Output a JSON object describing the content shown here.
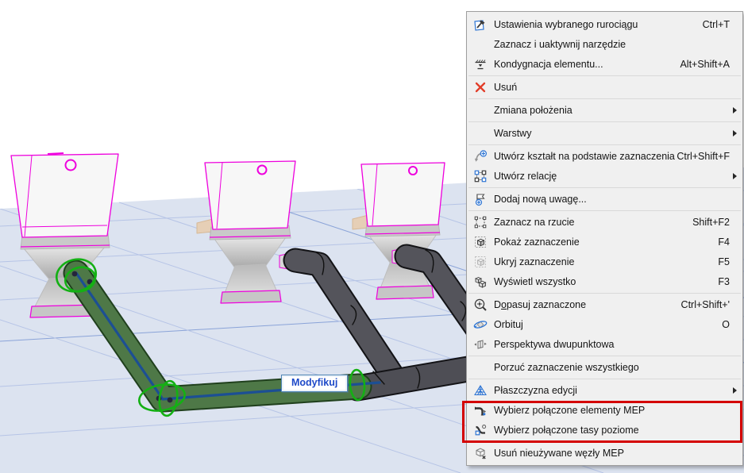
{
  "scene": {
    "tooltip": "Modyfikuj",
    "colors": {
      "floor": "#dce3f0",
      "grid_minor": "#b6c4e6",
      "grid_major": "#8aa3d8",
      "selection_green": "#14b014",
      "pipe_green": "#4e7847",
      "pipe_dark": "#54545b",
      "toilet_outline": "#ee00dd",
      "centerline_blue": "#1c4f94",
      "highlight_red": "#d40000",
      "tooltip_text": "#1d49c8"
    }
  },
  "menu": {
    "items": [
      {
        "label": "Ustawienia wybranego rurociągu",
        "shortcut": "Ctrl+T",
        "icon": "pipe-settings"
      },
      {
        "label": "Zaznacz i uaktywnij narzędzie",
        "shortcut": ""
      },
      {
        "label": "Kondygnacja elementu...",
        "shortcut": "Alt+Shift+A",
        "icon": "story-level"
      },
      {
        "label": "Usuń",
        "shortcut": "",
        "icon": "delete"
      },
      {
        "label": "Zmiana położenia",
        "shortcut": "",
        "submenu": true
      },
      {
        "label": "Warstwy",
        "shortcut": "",
        "submenu": true
      },
      {
        "label": "Utwórz kształt na podstawie zaznaczenia",
        "shortcut": "Ctrl+Shift+F",
        "icon": "morph-from-selection"
      },
      {
        "label": "Utwórz relację",
        "shortcut": "",
        "submenu": true,
        "icon": "create-relation"
      },
      {
        "label": "Dodaj nową uwagę...",
        "shortcut": "",
        "icon": "add-note"
      },
      {
        "label": "Zaznacz na rzucie",
        "shortcut": "Shift+F2",
        "icon": "select-on-plan"
      },
      {
        "label": "Pokaż zaznaczenie",
        "shortcut": "F4",
        "icon": "show-selection"
      },
      {
        "label": "Ukryj zaznaczenie",
        "shortcut": "F5",
        "icon": "hide-selection"
      },
      {
        "label": "Wyświetl wszystko",
        "shortcut": "F3",
        "icon": "show-all"
      },
      {
        "label": "Dopasuj zaznaczone",
        "label_pre": "D",
        "label_u": "o",
        "label_post": "pasuj zaznaczone",
        "shortcut": "Ctrl+Shift+'",
        "icon": "fit-selection"
      },
      {
        "label": "Orbituj",
        "shortcut": "O",
        "icon": "orbit"
      },
      {
        "label": "Perspektywa dwupunktowa",
        "shortcut": "",
        "icon": "two-point-perspective"
      },
      {
        "label": "Porzuć zaznaczenie wszystkiego",
        "shortcut": ""
      },
      {
        "label": "Płaszczyzna edycji",
        "shortcut": "",
        "submenu": true,
        "icon": "editing-plane"
      },
      {
        "label": "Wybierz połączone elementy MEP",
        "shortcut": "",
        "icon": "mep-connected-elements",
        "highlighted": true
      },
      {
        "label": "Wybierz połączone tasy poziome",
        "shortcut": "",
        "icon": "mep-connected-routes",
        "highlighted": true
      },
      {
        "label": "Usuń nieużywane węzły MEP",
        "shortcut": "",
        "icon": "delete-mep-nodes"
      }
    ]
  }
}
